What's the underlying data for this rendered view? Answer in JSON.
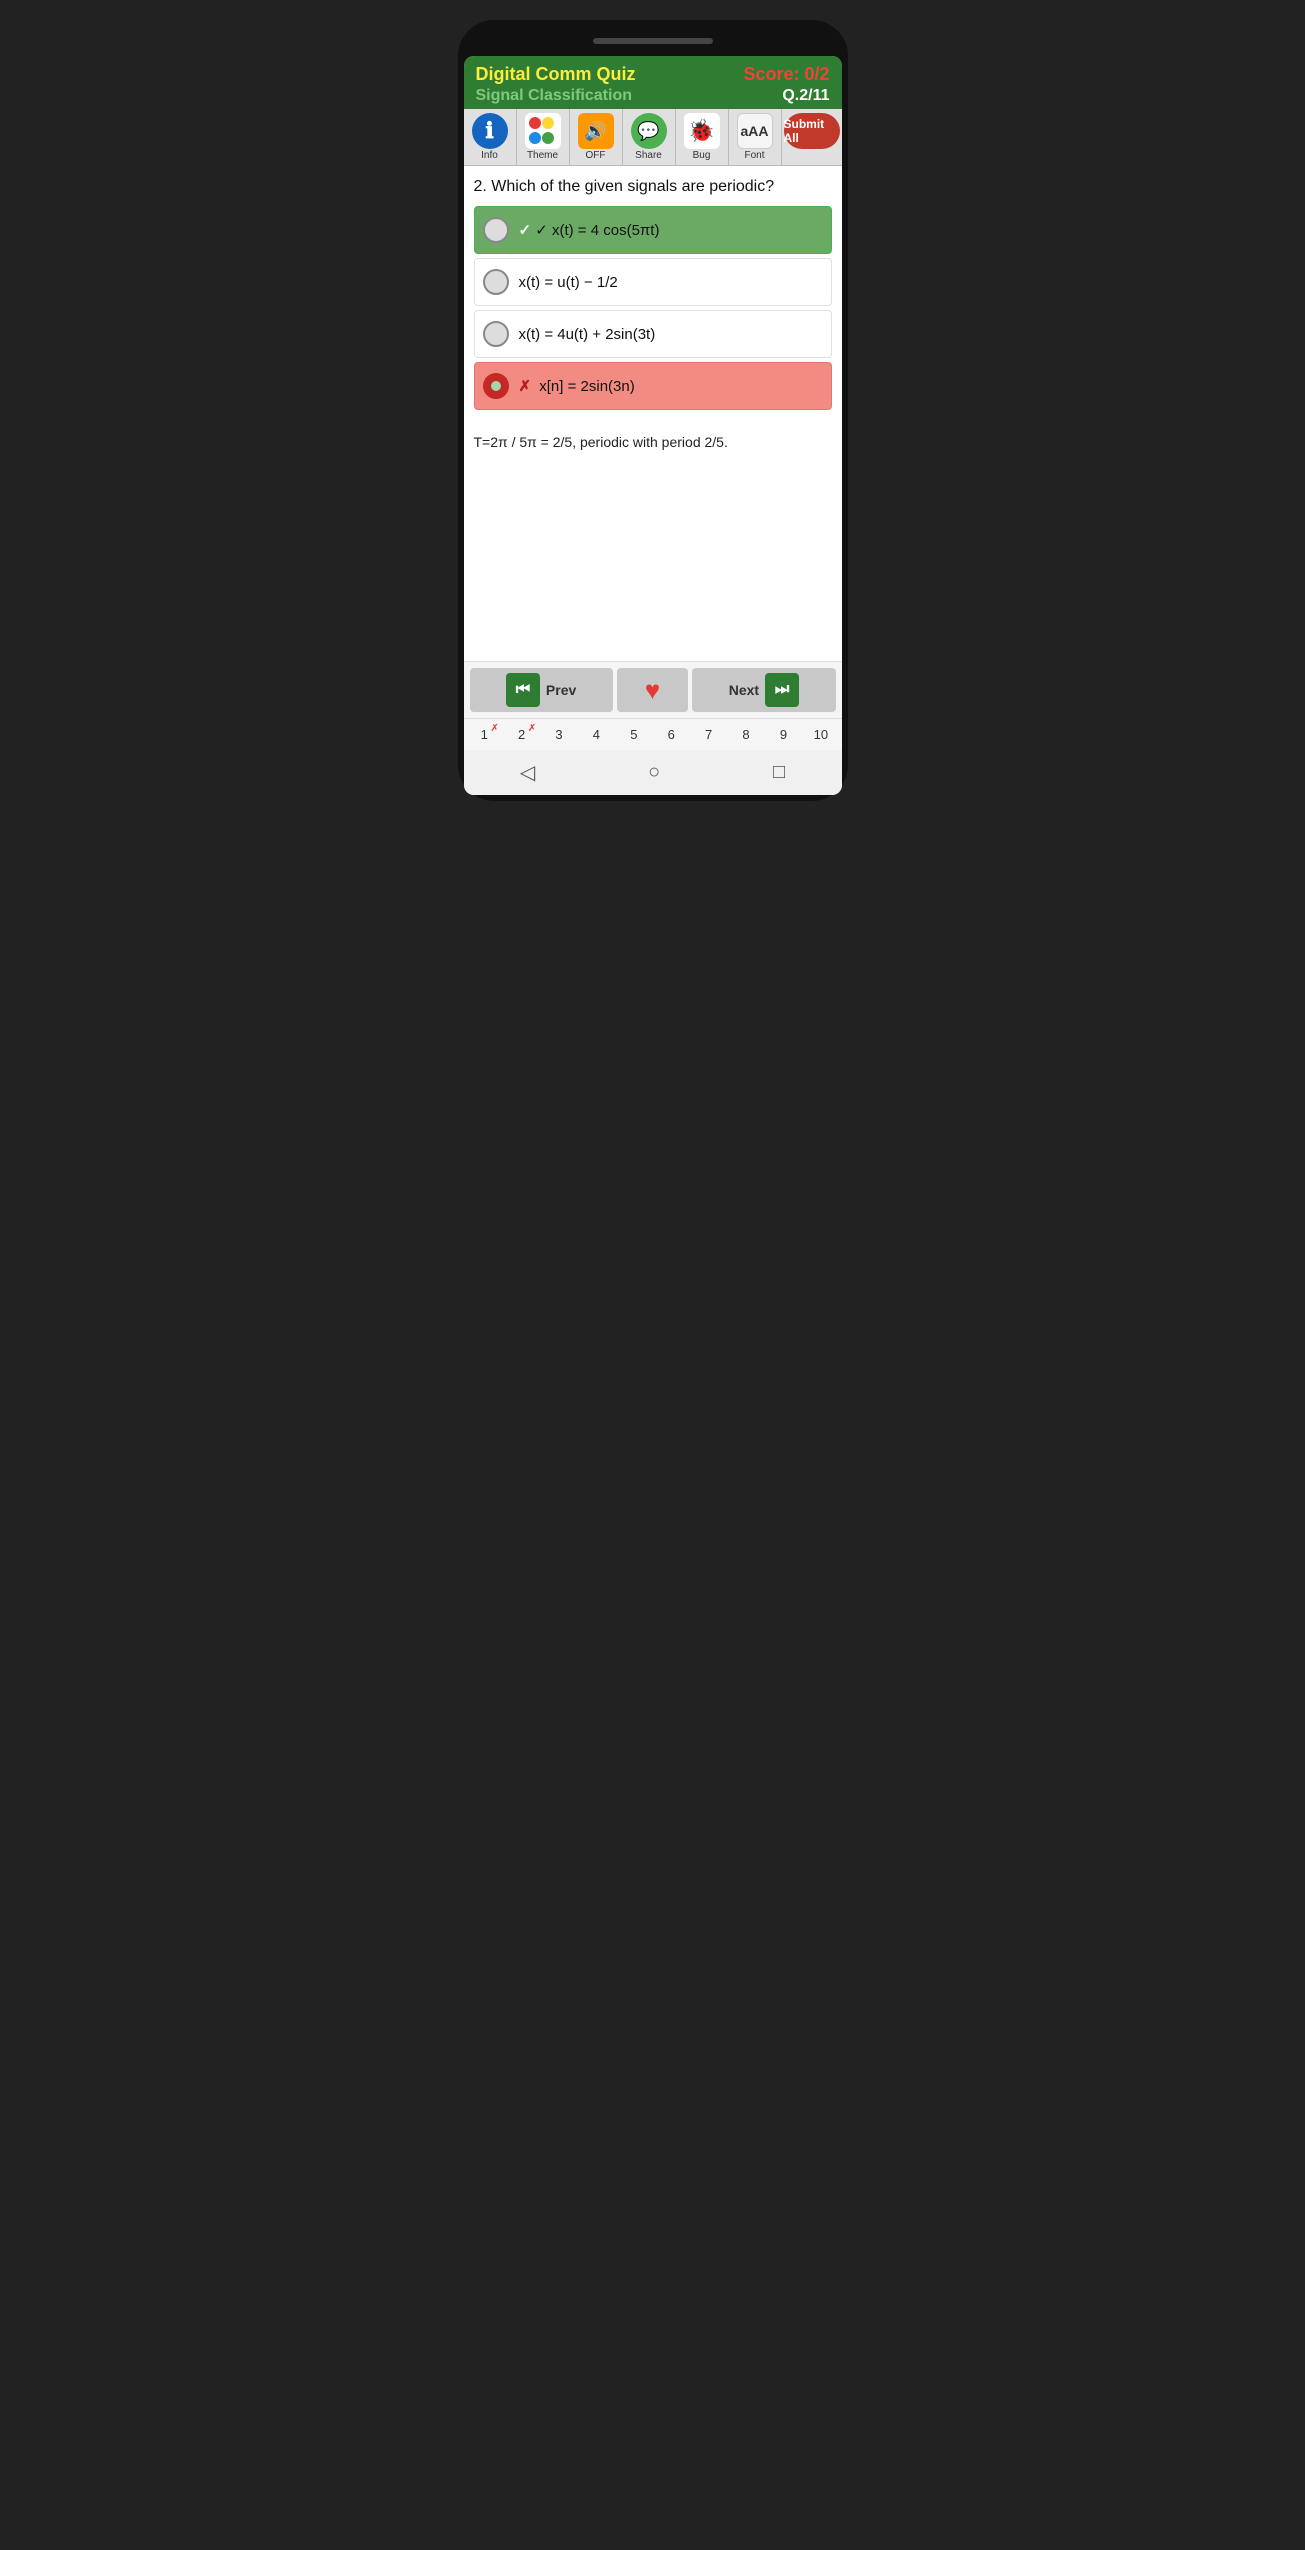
{
  "header": {
    "app_title": "Digital Comm Quiz",
    "score_label": "Score: 0/2",
    "subject_title": "Signal Classification",
    "question_num": "Q.2/11"
  },
  "toolbar": {
    "items": [
      {
        "label": "Info",
        "icon_type": "info"
      },
      {
        "label": "Theme",
        "icon_type": "theme"
      },
      {
        "label": "OFF",
        "icon_type": "sound"
      },
      {
        "label": "Share",
        "icon_type": "share"
      },
      {
        "label": "Bug",
        "icon_type": "bug"
      },
      {
        "label": "Font",
        "icon_type": "font"
      },
      {
        "label": "Submit All",
        "icon_type": "submit"
      }
    ]
  },
  "question": {
    "number": "2",
    "text": "Which of the given signals are periodic?"
  },
  "options": [
    {
      "id": 1,
      "text": "x(t) = 4 cos(5πt)",
      "state": "correct",
      "prefix": "✓ "
    },
    {
      "id": 2,
      "text": "x(t) = u(t) − 1/2",
      "state": "normal",
      "prefix": ""
    },
    {
      "id": 3,
      "text": "x(t) = 4u(t) + 2sin(3t)",
      "state": "normal",
      "prefix": ""
    },
    {
      "id": 4,
      "text": "x[n] = 2sin(3n)",
      "state": "incorrect",
      "prefix": "✗ "
    }
  ],
  "explanation": "T=2π / 5π = 2/5, periodic with period 2/5.",
  "navigation": {
    "prev_label": "Prev",
    "next_label": "Next",
    "heart_icon": "♥"
  },
  "q_nav": [
    "1",
    "2",
    "3",
    "4",
    "5",
    "6",
    "7",
    "8",
    "9",
    "10"
  ],
  "q_nav_errors": [
    0,
    1
  ],
  "system_nav": {
    "back": "◁",
    "home": "○",
    "recent": "□"
  }
}
